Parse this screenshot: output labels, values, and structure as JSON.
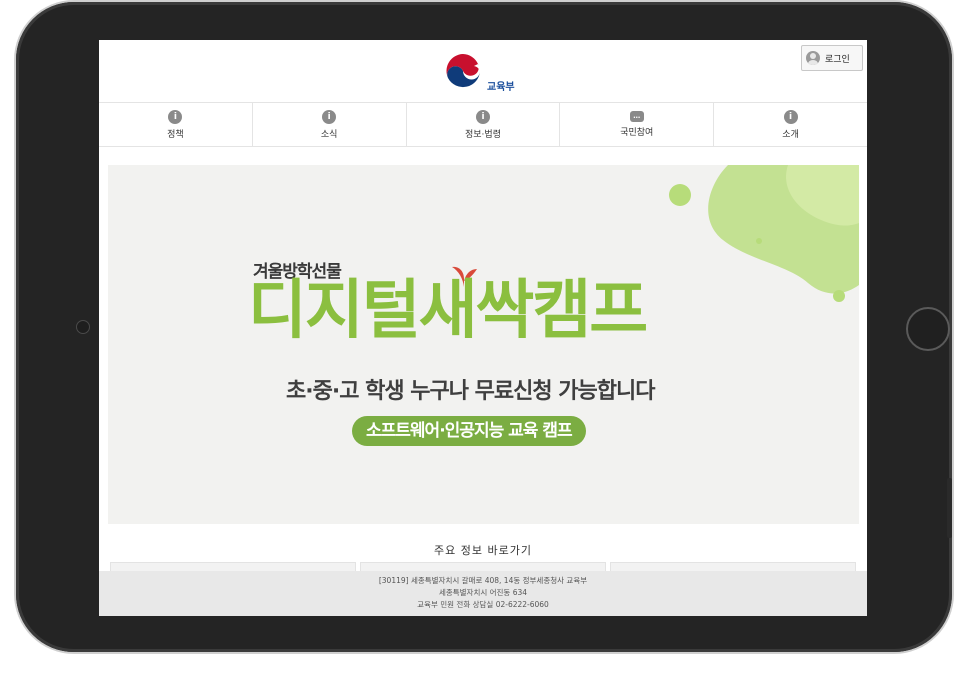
{
  "header": {
    "ministry_name": "교육부",
    "login_label": "로그인"
  },
  "nav": {
    "items": [
      {
        "label": "정책",
        "icon": "info-icon"
      },
      {
        "label": "소식",
        "icon": "info-icon"
      },
      {
        "label": "정보·법령",
        "icon": "info-icon"
      },
      {
        "label": "국민참여",
        "icon": "chat-icon"
      },
      {
        "label": "소개",
        "icon": "info-icon"
      }
    ]
  },
  "banner": {
    "subtitle": "겨울방학선물",
    "title": "디지털새싹캠프",
    "line": "초·중·고 학생 누구나 무료신청 가능합니다",
    "pill": "소프트웨어·인공지능 교육 캠프",
    "colors": {
      "title": "#8bbf3f",
      "pill": "#7bad42",
      "sprout": "#d94a3a"
    }
  },
  "quick": {
    "title": "주요 정보 바로가기"
  },
  "footer": {
    "address": "[30119] 세종특별자치시 갈매로 408, 14동 정부세종청사 교육부",
    "address2": "세종특별자치시 어진동 634",
    "phone": "교육부 민원 전화 상담실 02-6222-6060"
  }
}
